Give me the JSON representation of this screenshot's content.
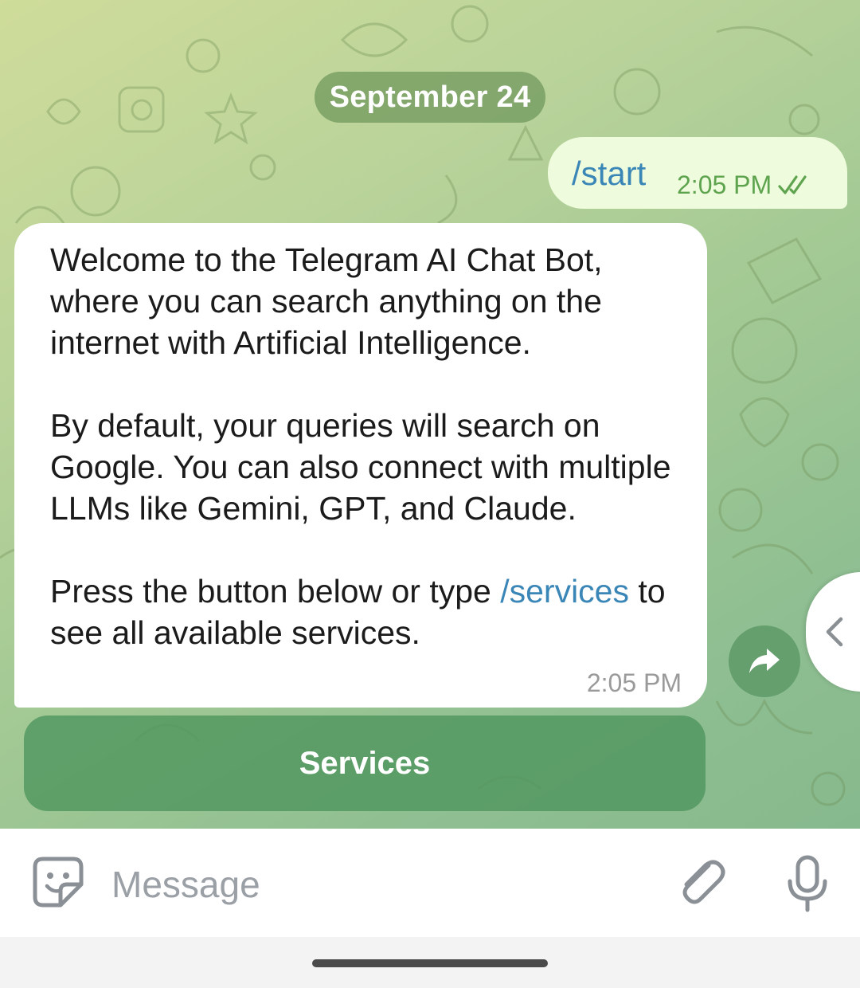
{
  "chat": {
    "date_label": "September 24",
    "outgoing": {
      "text": "/start",
      "time": "2:05 PM",
      "status": "read"
    },
    "incoming": {
      "paragraph1": "Welcome to the Telegram AI Chat Bot, where you can search anything on the internet with Artificial Intelligence.",
      "paragraph2": "By default, your queries will search on Google. You can also connect with multiple LLMs like Gemini, GPT, and Claude.",
      "paragraph3_prefix": "Press the button below or type ",
      "paragraph3_link": "/services",
      "paragraph3_suffix": " to see all available services.",
      "time": "2:05 PM"
    },
    "inline_button_label": "Services"
  },
  "composer": {
    "placeholder": "Message"
  },
  "colors": {
    "link": "#3a86b6",
    "outgoing_bubble": "#eefbdc",
    "read_check": "#5ea34e",
    "accent_green": "#50965f"
  },
  "icons": {
    "forward": "forward-arrow-icon",
    "side_handle": "chevron-left-icon",
    "emoji": "sticker-emoji-icon",
    "attach": "paperclip-icon",
    "mic": "microphone-icon",
    "read_status": "double-check-icon"
  }
}
